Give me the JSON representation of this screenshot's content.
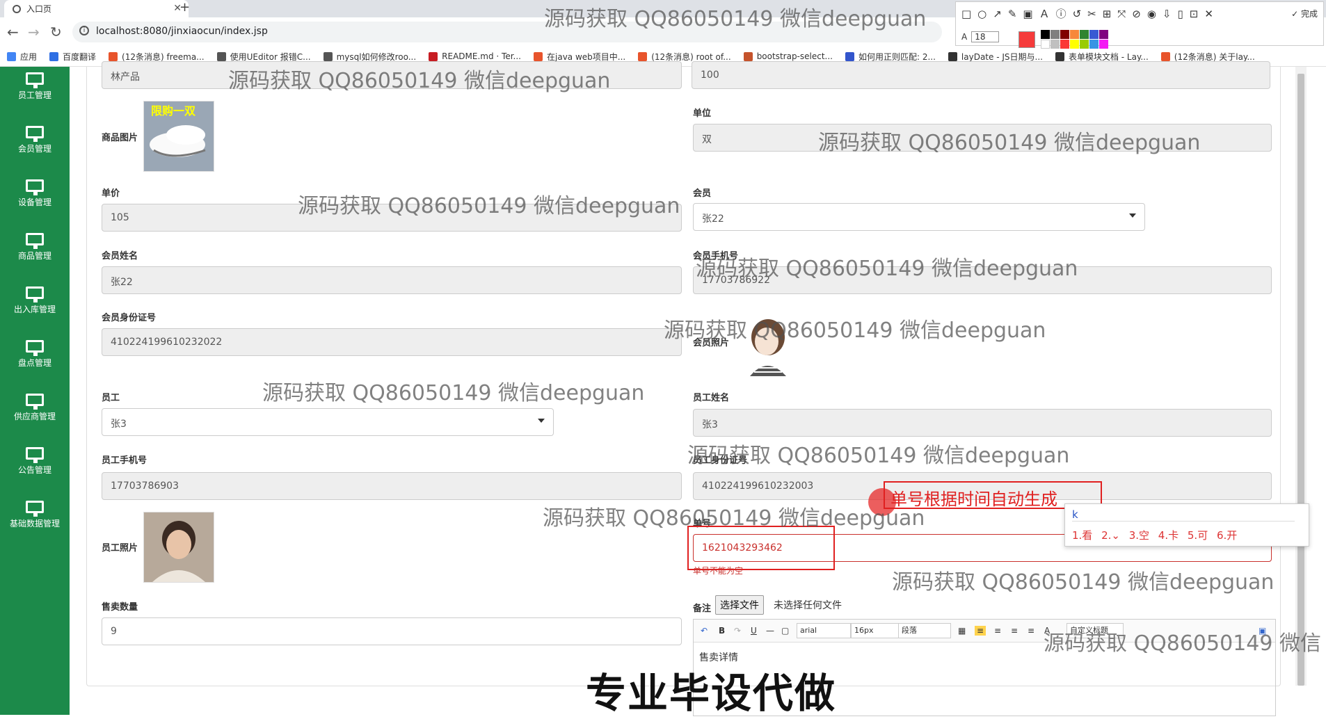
{
  "browser": {
    "tab_title": "入口页",
    "url": "localhost:8080/jinxiaocun/index.jsp",
    "bookmarks": [
      {
        "label": "应用",
        "color": "#4285f4"
      },
      {
        "label": "百度翻译",
        "color": "#2f6fe4"
      },
      {
        "label": "(12条消息) freema...",
        "color": "#e8542c"
      },
      {
        "label": "使用UEditor 报错C...",
        "color": "#555555"
      },
      {
        "label": "mysql如何修改roo...",
        "color": "#555555"
      },
      {
        "label": "README.md · Ter...",
        "color": "#c71d23"
      },
      {
        "label": "在java web项目中...",
        "color": "#e8542c"
      },
      {
        "label": "(12条消息) root of...",
        "color": "#e8542c"
      },
      {
        "label": "bootstrap-select...",
        "color": "#c5532c"
      },
      {
        "label": "如何用正则匹配: 2...",
        "color": "#3355cc"
      },
      {
        "label": "layDate - JS日期与...",
        "color": "#333333"
      },
      {
        "label": "表单模块文档 - Lay...",
        "color": "#333333"
      },
      {
        "label": "(12条消息) 关于lay...",
        "color": "#e8542c"
      }
    ]
  },
  "snap_tool": {
    "font_size": "18",
    "done_label": "完成"
  },
  "sidebar": {
    "items": [
      "员工管理",
      "会员管理",
      "设备管理",
      "商品管理",
      "出入库管理",
      "盘点管理",
      "供应商管理",
      "公告管理",
      "基础数据管理"
    ]
  },
  "form": {
    "product_name_value": "林产品",
    "top_right_value": "100",
    "product_image_label": "商品图片",
    "product_image_banner": "限购一双",
    "unit_label": "单位",
    "unit_value": "双",
    "price_label": "单价",
    "price_value": "105",
    "member_label": "会员",
    "member_value": "张22",
    "member_name_label": "会员姓名",
    "member_name_value": "张22",
    "member_phone_label": "会员手机号",
    "member_phone_value": "17703786922",
    "member_id_label": "会员身份证号",
    "member_id_value": "410224199610232022",
    "member_photo_label": "会员照片",
    "employee_label": "员工",
    "employee_value": "张3",
    "employee_name_label": "员工姓名",
    "employee_name_value": "张3",
    "employee_phone_label": "员工手机号",
    "employee_phone_value": "17703786903",
    "employee_id_label": "员工身份证号",
    "employee_id_value": "410224199610232003",
    "employee_photo_label": "员工照片",
    "order_no_label": "单号",
    "order_no_value": "1621043293462",
    "order_no_error": "单号不能为空",
    "qty_label": "售卖数量",
    "qty_value": "9",
    "remark_label": "备注",
    "file_button": "选择文件",
    "file_none": "未选择任何文件",
    "editor_font": "arial",
    "editor_size": "16px",
    "editor_para": "段落",
    "editor_custom": "自定义标题",
    "editor_text": "售卖详情"
  },
  "annotation": {
    "note": "单号根据时间自动生成",
    "ime_composition": "k",
    "ime_candidates": "1.看 2.⌄ 3.空 4.卡 5.可 6.开"
  },
  "watermark_text": "源码获取 QQ86050149 微信deepguan",
  "footer_banner": "专业毕设代做"
}
